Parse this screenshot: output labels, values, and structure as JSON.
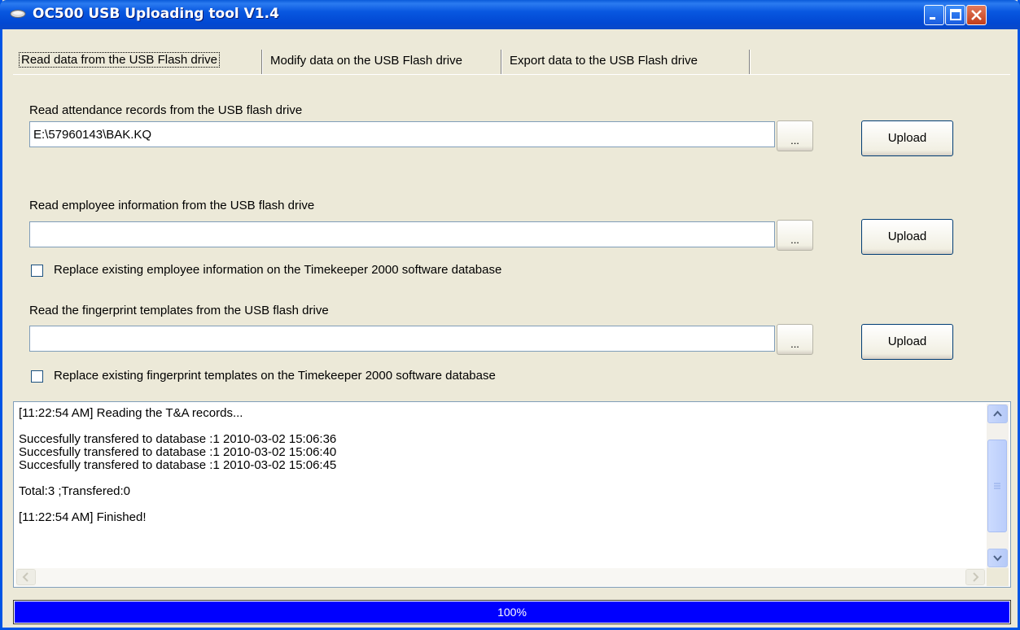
{
  "window": {
    "title": "OC500 USB Uploading tool V1.4",
    "icon": "usb-drive-icon"
  },
  "tabs": [
    {
      "label": "Read data from the USB Flash drive",
      "active": true
    },
    {
      "label": "Modify data on the USB Flash drive",
      "active": false
    },
    {
      "label": "Export data to the USB Flash drive",
      "active": false
    }
  ],
  "attendance": {
    "label": "Read attendance records from the USB flash drive",
    "path": "E:\\57960143\\BAK.KQ",
    "browse_label": "...",
    "upload_label": "Upload"
  },
  "employee": {
    "label": "Read employee information from the USB flash drive",
    "path": "",
    "browse_label": "...",
    "upload_label": "Upload",
    "replace_label": "Replace existing employee information on the Timekeeper 2000 software database",
    "replace_checked": false
  },
  "fingerprint": {
    "label": "Read the fingerprint templates from the USB flash drive",
    "path": "",
    "browse_label": "...",
    "upload_label": "Upload",
    "replace_label": "Replace existing fingerprint templates on the Timekeeper 2000 software database",
    "replace_checked": false
  },
  "log": {
    "lines": [
      "[11:22:54 AM] Reading the T&A records...",
      "",
      "Succesfully transfered to database :1 2010-03-02 15:06:36",
      "Succesfully transfered to database :1 2010-03-02 15:06:40",
      "Succesfully transfered to database :1 2010-03-02 15:06:45",
      "",
      "Total:3 ;Transfered:0",
      "",
      "[11:22:54 AM] Finished!"
    ]
  },
  "progress": {
    "value": 100,
    "label": "100%"
  },
  "colors": {
    "titlebar": "#0054E3",
    "window_bg": "#ECE9D8",
    "progress_fill": "#0000FF"
  }
}
